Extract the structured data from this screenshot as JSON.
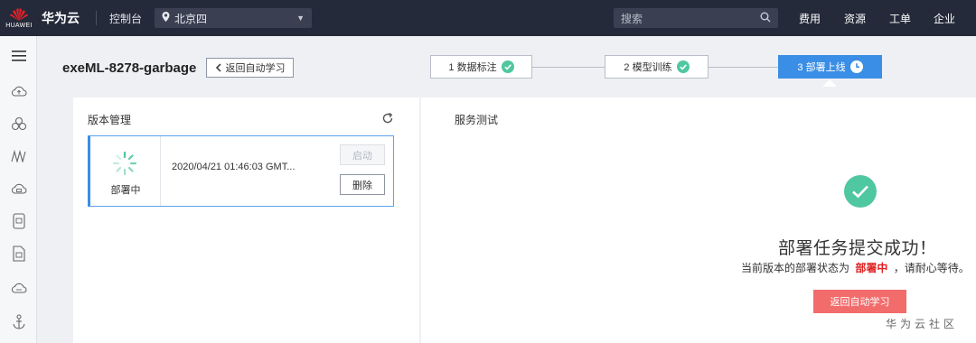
{
  "topbar": {
    "logo_text": "HUAWEI",
    "brand": "华为云",
    "console": "控制台",
    "region": "北京四",
    "search_placeholder": "搜索",
    "nav": [
      "费用",
      "资源",
      "工单",
      "企业"
    ]
  },
  "sidebar": {
    "icons": [
      "menu-icon",
      "cloud-upload-icon",
      "model-icon",
      "algorithm-icon",
      "cloud-service-icon",
      "device-icon",
      "document-icon",
      "cloud-icon",
      "anchor-icon"
    ]
  },
  "header": {
    "title": "exeML-8278-garbage",
    "back_label": "返回自动学习",
    "steps": [
      {
        "label": "1 数据标注",
        "state": "done"
      },
      {
        "label": "2 模型训练",
        "state": "done"
      },
      {
        "label": "3 部署上线",
        "state": "in-progress"
      }
    ]
  },
  "version_panel": {
    "title": "版本管理",
    "card": {
      "status": "部署中",
      "timestamp": "2020/04/21 01:46:03 GMT...",
      "start_label": "启动",
      "delete_label": "删除"
    }
  },
  "service_panel": {
    "title": "服务测试",
    "success_title": "部署任务提交成功！",
    "desc_prefix": "当前版本的部署状态为",
    "desc_status": "部署中",
    "desc_suffix": "，请耐心等待。",
    "return_label": "返回自动学习"
  },
  "watermark": "华为云社区",
  "colors": {
    "topbar_bg": "#252a3a",
    "accent_blue": "#3a8ee6",
    "success_green": "#4fc7a0",
    "danger_red": "#f26c6c",
    "status_red": "#e02020"
  }
}
